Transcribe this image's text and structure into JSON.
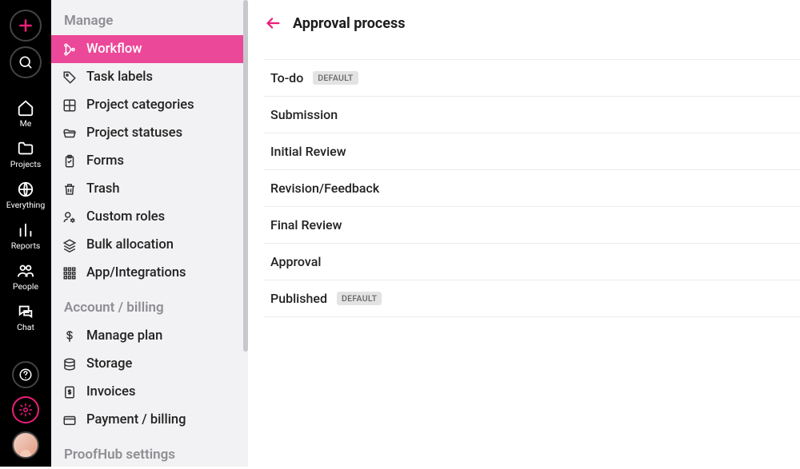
{
  "rail": {
    "nav": [
      {
        "id": "me",
        "label": "Me"
      },
      {
        "id": "projects",
        "label": "Projects"
      },
      {
        "id": "everything",
        "label": "Everything"
      },
      {
        "id": "reports",
        "label": "Reports"
      },
      {
        "id": "people",
        "label": "People"
      },
      {
        "id": "chat",
        "label": "Chat"
      }
    ]
  },
  "sidebar": {
    "sections": [
      {
        "title": "Manage",
        "items": [
          {
            "id": "workflow",
            "label": "Workflow",
            "active": true
          },
          {
            "id": "task-labels",
            "label": "Task labels"
          },
          {
            "id": "project-categories",
            "label": "Project categories"
          },
          {
            "id": "project-statuses",
            "label": "Project statuses"
          },
          {
            "id": "forms",
            "label": "Forms"
          },
          {
            "id": "trash",
            "label": "Trash"
          },
          {
            "id": "custom-roles",
            "label": "Custom roles"
          },
          {
            "id": "bulk-allocation",
            "label": "Bulk allocation"
          },
          {
            "id": "app-integrations",
            "label": "App/Integrations"
          }
        ]
      },
      {
        "title": "Account / billing",
        "items": [
          {
            "id": "manage-plan",
            "label": "Manage plan"
          },
          {
            "id": "storage",
            "label": "Storage"
          },
          {
            "id": "invoices",
            "label": "Invoices"
          },
          {
            "id": "payment-billing",
            "label": "Payment / billing"
          }
        ]
      },
      {
        "title": "ProofHub settings",
        "items": []
      }
    ]
  },
  "main": {
    "title": "Approval process",
    "default_badge": "DEFAULT",
    "stages": [
      {
        "name": "To-do",
        "default": true
      },
      {
        "name": "Submission"
      },
      {
        "name": "Initial Review"
      },
      {
        "name": "Revision/Feedback"
      },
      {
        "name": "Final Review"
      },
      {
        "name": "Approval"
      },
      {
        "name": "Published",
        "default": true
      }
    ]
  }
}
